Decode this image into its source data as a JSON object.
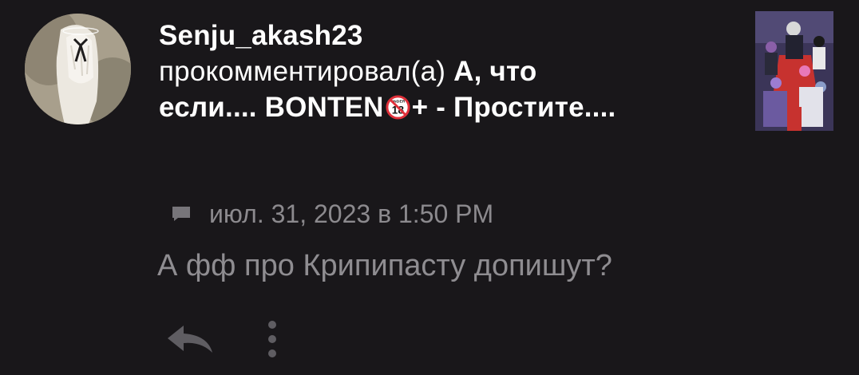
{
  "notification": {
    "username": "Senju_akash23",
    "action_text": "прокомментировал(а)",
    "story_title_part1": "А, что если.... BONTEN",
    "story_title_part2": "+ - Простите....",
    "badge_text": "UNDER",
    "badge_number": "18",
    "timestamp": "июл. 31, 2023 в 1:50 PM",
    "comment_text": "А фф про Крипипасту допишут?"
  },
  "icons": {
    "avatar": "avatar-image",
    "thumbnail": "story-cover-image",
    "meta": "comment-icon",
    "reply": "reply-arrow-icon",
    "more": "more-vertical-icon"
  },
  "colors": {
    "background": "#19171a",
    "primary_text": "#ffffff",
    "secondary_text": "#8c8a8e",
    "icon_gray": "#77757a",
    "badge_red": "#e0303a"
  }
}
